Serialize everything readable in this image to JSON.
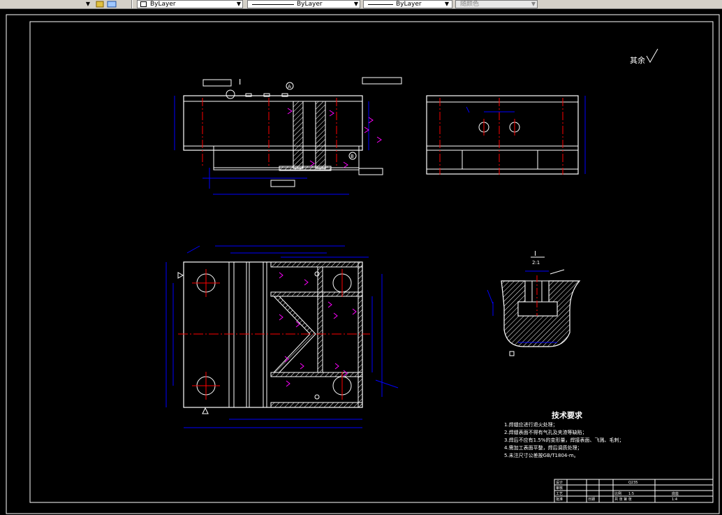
{
  "toolbar": {
    "layer_dropdown_value": "ByLayer",
    "linetype_dropdown_value": "ByLayer",
    "lineweight_dropdown_value": "ByLayer",
    "plotstyle_dropdown_value": "随颜色"
  },
  "drawing": {
    "surface_finish_label": "其余",
    "detail_label": "I",
    "balloon_a": "A",
    "balloon_b": "B",
    "detail_scale": "2:1",
    "tech_req_title": "技术要求",
    "tech_req_items": [
      "1.焊缝应进行退火处理；",
      "2.焊缝表面不得有气孔及夹渣等缺陷；",
      "3.焊后不应有1.5%的变形量，焊接表面、飞溅、毛刺；",
      "4.需加工表面平整，焊后调质处理；",
      "5.未注尺寸公差按GB/T1804-m。"
    ],
    "title_block": {
      "design": "设计",
      "check": "审核",
      "process": "工艺",
      "approve": "批准",
      "scale_label": "比例",
      "scale_value": "1:5",
      "material": "Q235",
      "part_name": "底座",
      "sheet": "共  张  第  张",
      "sheet_no": "1:4",
      "date": "日期"
    }
  },
  "colors": {
    "outline": "#ffffff",
    "dimension": "#0000ff",
    "centerline": "#ff0000",
    "weld": "#ff00ff",
    "hatch": "#ffffff",
    "background": "#000000"
  }
}
